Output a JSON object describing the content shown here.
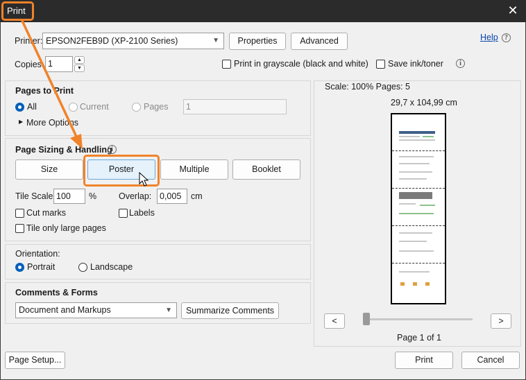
{
  "window": {
    "title": "Print",
    "close": "✕"
  },
  "printer": {
    "label": "Printer:",
    "selected": "EPSON2FEB9D (XP-2100 Series)",
    "properties": "Properties",
    "advanced": "Advanced",
    "help": "Help",
    "copies_label": "Copies:",
    "copies_value": "1",
    "grayscale_label": "Print in grayscale (black and white)",
    "save_ink_label": "Save ink/toner"
  },
  "pages_to_print": {
    "title": "Pages to Print",
    "all": "All",
    "current": "Current",
    "pages": "Pages",
    "pages_value": "1",
    "more_options": "More Options"
  },
  "sizing": {
    "title": "Page Sizing & Handling",
    "buttons": [
      "Size",
      "Poster",
      "Multiple",
      "Booklet"
    ],
    "active": "Poster",
    "tile_scale_label": "Tile Scale:",
    "tile_scale_value": "100",
    "percent": "%",
    "overlap_label": "Overlap:",
    "overlap_value": "0,005",
    "overlap_unit": "cm",
    "cut_marks": "Cut marks",
    "labels": "Labels",
    "tile_large": "Tile only large pages"
  },
  "orientation": {
    "title": "Orientation:",
    "portrait": "Portrait",
    "landscape": "Landscape"
  },
  "comments": {
    "title": "Comments & Forms",
    "selected": "Document and Markups",
    "summarize": "Summarize Comments"
  },
  "preview": {
    "scale_text": "Scale: 100% Pages: 5",
    "dimensions": "29,7 x 104,99 cm",
    "prev": "<",
    "next": ">",
    "page_of": "Page 1 of 1"
  },
  "footer": {
    "page_setup": "Page Setup...",
    "print": "Print",
    "cancel": "Cancel"
  },
  "colors": {
    "accent": "#f0832a",
    "selection": "#005fb8",
    "link": "#0645ad"
  }
}
